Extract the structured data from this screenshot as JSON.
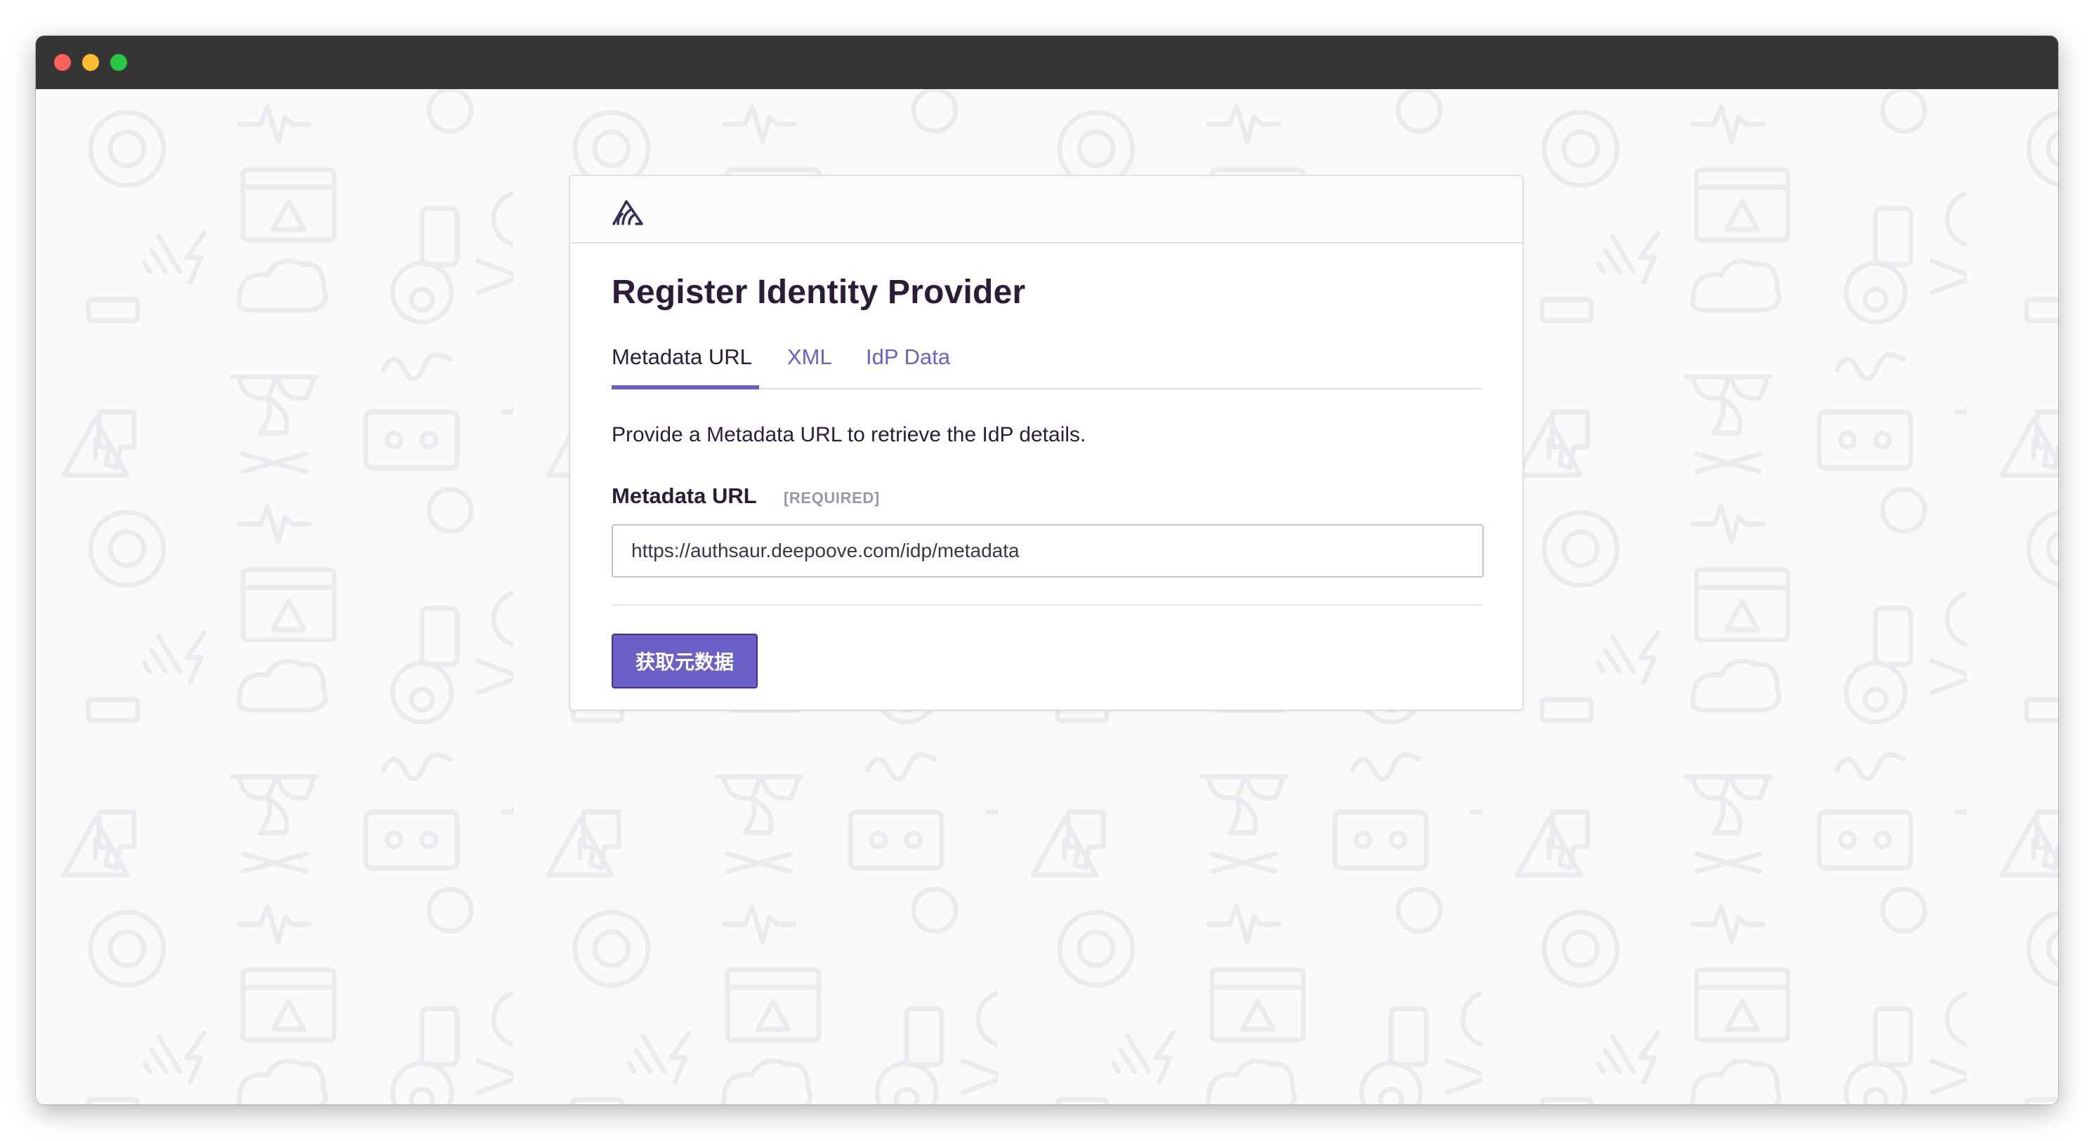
{
  "window": {
    "controls": [
      "close",
      "minimize",
      "maximize"
    ]
  },
  "card": {
    "logo_icon": "sentry-logo-icon",
    "title": "Register Identity Provider",
    "tabs": [
      {
        "label": "Metadata URL",
        "active": true
      },
      {
        "label": "XML",
        "active": false
      },
      {
        "label": "IdP Data",
        "active": false
      }
    ],
    "description": "Provide a Metadata URL to retrieve the IdP details.",
    "field": {
      "label": "Metadata URL",
      "required_tag": "[REQUIRED]",
      "value": "https://authsaur.deepoove.com/idp/metadata",
      "placeholder": ""
    },
    "submit_label": "获取元数据"
  },
  "colors": {
    "accent": "#6c5fc7",
    "accent_border": "#3f3391",
    "text_primary": "#2b1d38",
    "text_muted": "#9e94a8",
    "background": "#fafafa",
    "pattern": "#ebe9ed",
    "titlebar": "#353535",
    "traffic_close": "#fe5f57",
    "traffic_min": "#febc2e",
    "traffic_max": "#28c840"
  },
  "background_pattern_icons": [
    "lifebuoy-icon",
    "warning-triangle-icon",
    "skull-crossbones-icon",
    "radiation-icon",
    "cassette-icon",
    "404-tag-icon",
    "cloud-icon",
    "sunglasses-icon",
    "thumbs-down-icon",
    "campfire-icon",
    "traffic-cone-icon",
    "gas-mask-icon",
    "lightning-icon",
    "heartbeat-icon",
    "sentry-wordmark-icon"
  ]
}
